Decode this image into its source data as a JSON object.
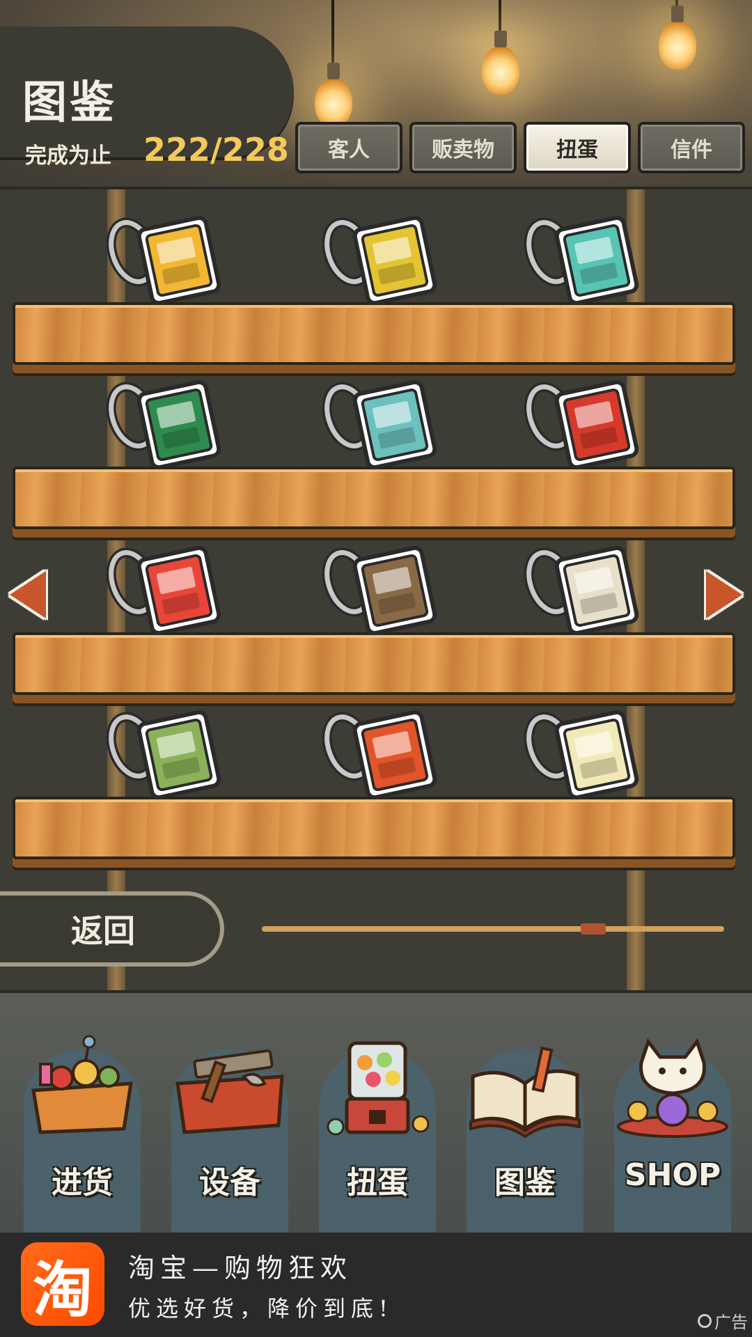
{
  "header": {
    "title": "图鉴",
    "progress_label": "完成为止",
    "progress_value": "222/228"
  },
  "tabs": [
    {
      "label": "客人",
      "active": false
    },
    {
      "label": "贩卖物",
      "active": false
    },
    {
      "label": "扭蛋",
      "active": true
    },
    {
      "label": "信件",
      "active": false
    }
  ],
  "shelf_items": [
    {
      "icon": "vending-machine-keychain-icon",
      "color": "#f2b733"
    },
    {
      "icon": "decorated-bus-keychain-icon",
      "color": "#e3c432"
    },
    {
      "icon": "teal-vending-machine-keychain-icon",
      "color": "#58c4b4"
    },
    {
      "icon": "green-card-binder-keychain-icon",
      "color": "#2f8a4e"
    },
    {
      "icon": "three-wheel-truck-keychain-icon",
      "color": "#6cc1bf"
    },
    {
      "icon": "tamago-sign-keychain-icon",
      "color": "#d63a2a"
    },
    {
      "icon": "moriori-card-keychain-icon",
      "color": "#e9463a"
    },
    {
      "icon": "arcade-cabinet-keychain-icon",
      "color": "#8a6a46"
    },
    {
      "icon": "handheld-game-keychain-icon",
      "color": "#e8e0c8"
    },
    {
      "icon": "green-radio-keychain-icon",
      "color": "#8bb25a"
    },
    {
      "icon": "claw-machine-keychain-icon",
      "color": "#e2552b"
    },
    {
      "icon": "cocktail-glass-keychain-icon",
      "color": "#f1e9b8"
    }
  ],
  "navigation": {
    "back_label": "返回",
    "page_position": 0.73
  },
  "bottom_nav": [
    {
      "label": "进货",
      "icon": "goods-basket-icon"
    },
    {
      "label": "设备",
      "icon": "toolbox-icon"
    },
    {
      "label": "扭蛋",
      "icon": "gacha-machine-icon"
    },
    {
      "label": "图鉴",
      "icon": "open-book-icon"
    },
    {
      "label": "SHOP",
      "icon": "lucky-cat-icon"
    }
  ],
  "ad": {
    "logo_text": "淘",
    "title": "淘宝—购物狂欢",
    "subtitle": "优选好货，降价到底!",
    "tag": "广告"
  }
}
